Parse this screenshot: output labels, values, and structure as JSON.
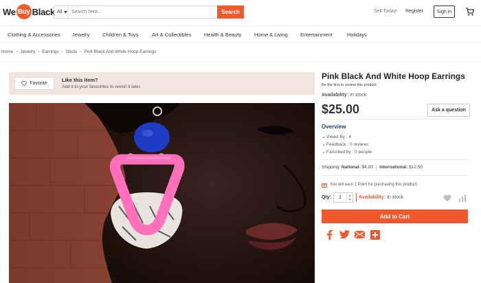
{
  "brand": {
    "name_we": "We",
    "name_buy": "Buy",
    "name_black": "Black",
    "accent": "#f0592b"
  },
  "search": {
    "category": "All",
    "placeholder": "Search here...",
    "button_label": "Search"
  },
  "header": {
    "sell_today": "Sell Today!",
    "register": "Register",
    "sign_in": "Sign in",
    "cart_icon": "cart-icon"
  },
  "nav": {
    "items": [
      "Clothing & Accessories",
      "Jewelry",
      "Children & Toys",
      "Art & Collectibles",
      "Health & Beauty",
      "Home & Living",
      "Entertainment",
      "Holidays"
    ]
  },
  "breadcrumb": {
    "items": [
      "Home",
      "Jewelry",
      "Earrings",
      "Studs",
      "Pink Black And White Hoop Earrings"
    ]
  },
  "favorite": {
    "button_label": "Favorite",
    "title": "Like this item?",
    "subtitle": "Add it to your favourites to revisit it later."
  },
  "product": {
    "title": "Pink Black And White Hoop Earrings",
    "review_text": "Be the first to review this product",
    "availability_label": "Availability:",
    "availability_value": "In stock",
    "price": "$25.00",
    "ask_question": "Ask a question",
    "overview_title": "Overview",
    "overview": [
      "Viewd By : 4",
      "Feedback : 0 reviews",
      "Favorited by : 0 people"
    ],
    "shipping_label": "Shipping:",
    "national_label": "National:",
    "national_value": "$4.00",
    "international_label": "International:",
    "international_value": "$12.50",
    "points_text": "You will earn 1 Point for purchasing this product.",
    "qty_label": "Qty:",
    "qty_value": "1",
    "availability2_label": "Availability:",
    "availability2_value": "In stock",
    "add_to_cart": "Add to Cart"
  },
  "share": {
    "icons": [
      "facebook-icon",
      "twitter-icon",
      "email-icon",
      "plus-icon"
    ]
  }
}
